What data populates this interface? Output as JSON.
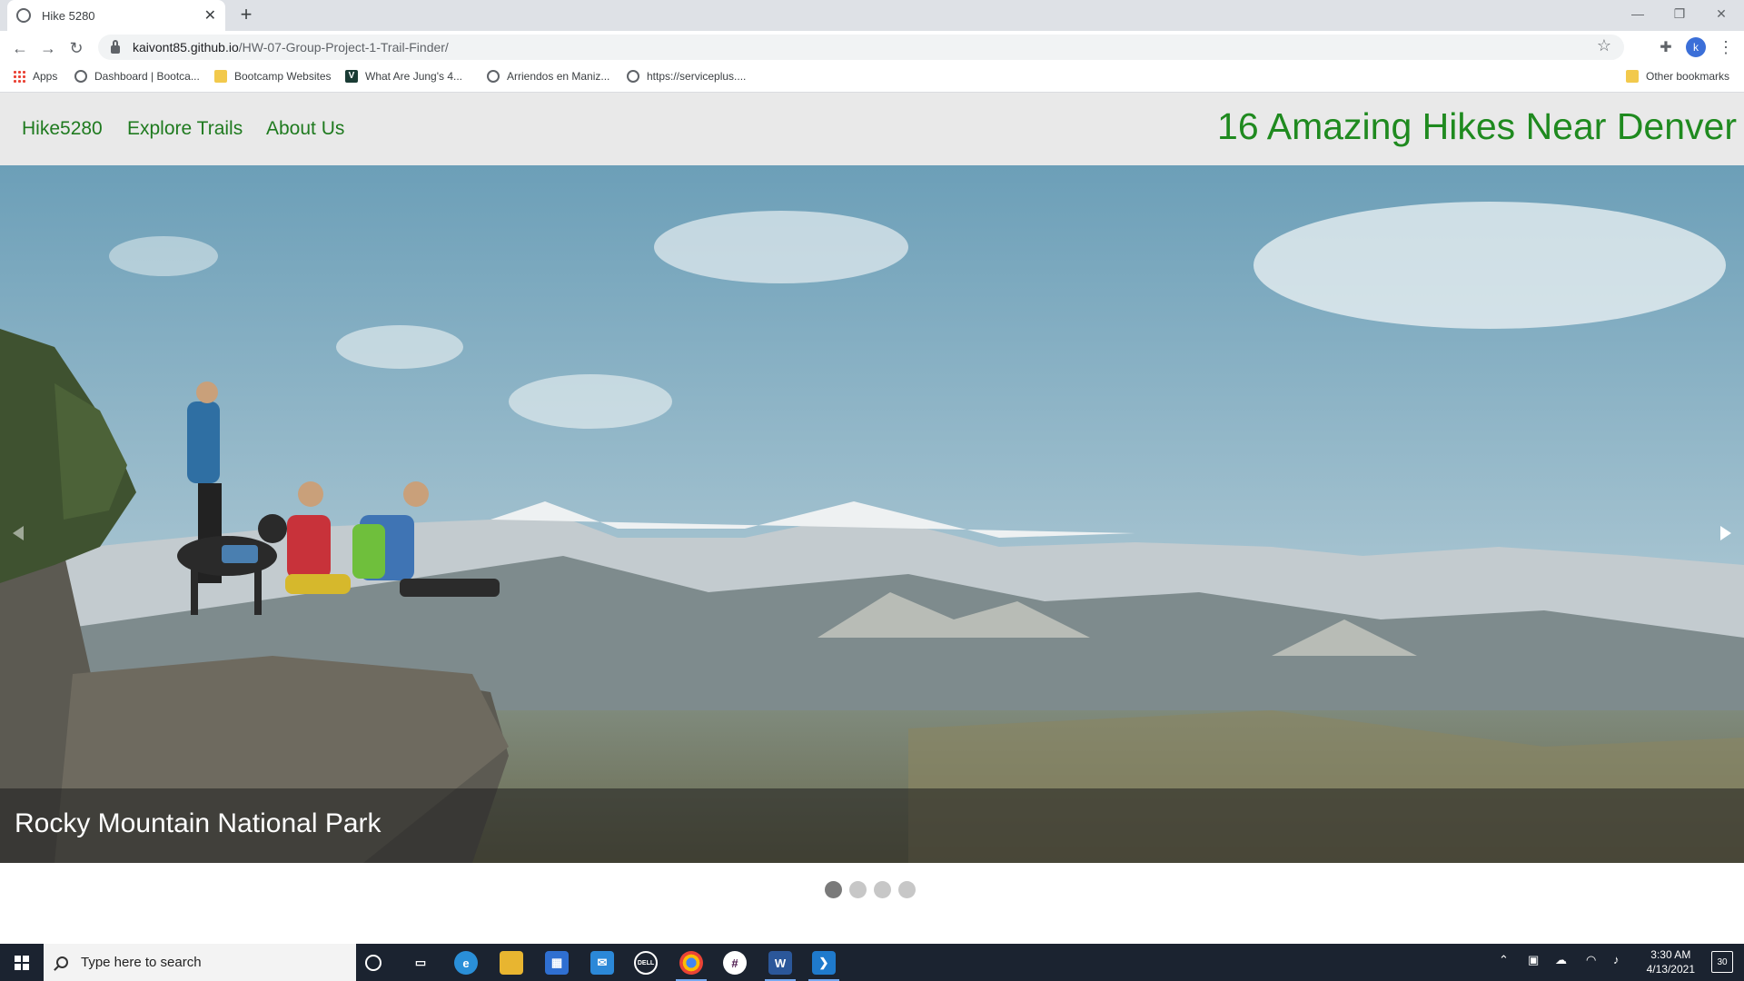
{
  "browser": {
    "tab_title": "Hike 5280",
    "url_host": "kaivont85.github.io",
    "url_path": "/HW-07-Group-Project-1-Trail-Finder/",
    "bookmarks": [
      {
        "label": "Apps",
        "icon": "apps-grid-icon"
      },
      {
        "label": "Dashboard | Bootca...",
        "icon": "globe-icon"
      },
      {
        "label": "Bootcamp Websites",
        "icon": "folder-icon"
      },
      {
        "label": "What Are Jung's 4...",
        "icon": "v-site-icon"
      },
      {
        "label": "Arriendos en Maniz...",
        "icon": "globe-icon"
      },
      {
        "label": "https://serviceplus....",
        "icon": "globe-icon"
      }
    ],
    "other_bookmarks": "Other bookmarks",
    "profile_initial": "k"
  },
  "site": {
    "nav": {
      "brand": "Hike5280",
      "explore": "Explore Trails",
      "about": "About Us"
    },
    "heading": "16 Amazing Hikes Near Denver",
    "accent_color": "#1f8a1f"
  },
  "carousel": {
    "caption": "Rocky Mountain National Park",
    "slide_count": 4,
    "active_slide": 1
  },
  "taskbar": {
    "search_placeholder": "Type here to search",
    "time": "3:30 AM",
    "date": "4/13/2021",
    "notifications": "30",
    "dell_label": "DELL",
    "word_label": "W"
  }
}
